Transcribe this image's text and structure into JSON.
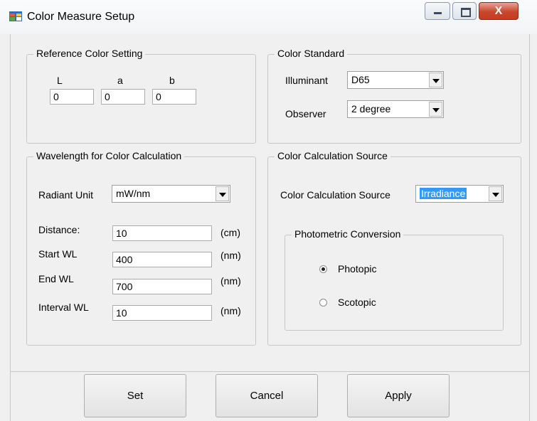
{
  "window": {
    "title": "Color Measure Setup",
    "close_glyph": "X"
  },
  "reference_color": {
    "legend": "Reference Color Setting",
    "l_label": "L",
    "a_label": "a",
    "b_label": "b",
    "l_value": "0",
    "a_value": "0",
    "b_value": "0"
  },
  "color_standard": {
    "legend": "Color Standard",
    "illuminant_label": "Illuminant",
    "illuminant_value": "D65",
    "observer_label": "Observer",
    "observer_value": "2 degree"
  },
  "wavelength": {
    "legend": "Wavelength for Color Calculation",
    "radiant_unit_label": "Radiant Unit",
    "radiant_unit_value": "mW/nm",
    "distance_label": "Distance:",
    "distance_value": "10",
    "distance_unit": "(cm)",
    "start_label": "Start WL",
    "start_value": "400",
    "start_unit": "(nm)",
    "end_label": "End WL",
    "end_value": "700",
    "end_unit": "(nm)",
    "interval_label": "Interval WL",
    "interval_value": "10",
    "interval_unit": "(nm)"
  },
  "calc_source": {
    "legend": "Color Calculation Source",
    "source_label": "Color Calculation Source",
    "source_value": "Irradiance",
    "photometric": {
      "legend": "Photometric Conversion",
      "photopic_label": "Photopic",
      "scotopic_label": "Scotopic",
      "selected": "Photopic"
    }
  },
  "buttons": {
    "set": "Set",
    "cancel": "Cancel",
    "apply": "Apply"
  },
  "colors": {
    "selection": "#3399ff",
    "close_button": "#c73b20"
  },
  "icons": [
    "app-icon",
    "minimize-icon",
    "maximize-icon",
    "close-icon",
    "dropdown-arrow-icon"
  ]
}
